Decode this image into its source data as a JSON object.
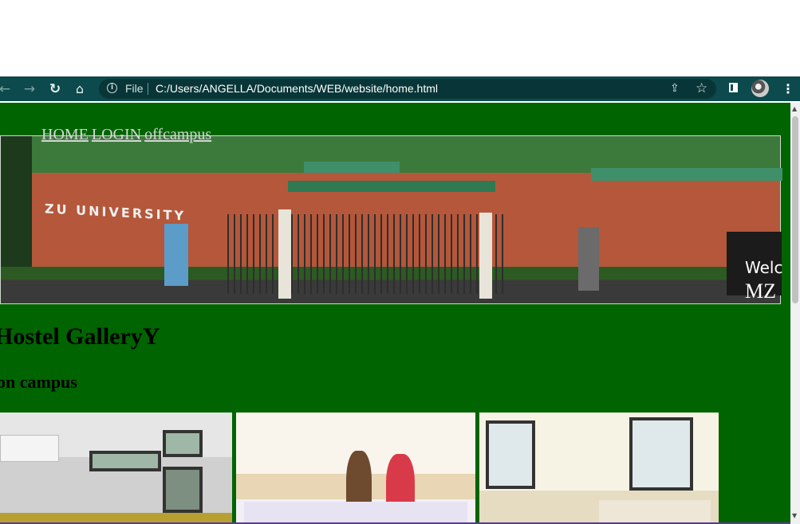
{
  "browser": {
    "url": "C:/Users/ANGELLA/Documents/WEB/website/home.html",
    "file_label": "File",
    "icons": [
      "back-arrow-icon",
      "forward-arrow-icon",
      "reload-icon",
      "home-icon",
      "info-icon",
      "share-icon",
      "star-icon",
      "side-panel-icon",
      "avatar",
      "kebab-menu-icon"
    ]
  },
  "nav": {
    "links": [
      {
        "label": "HOME"
      },
      {
        "label": "LOGIN"
      },
      {
        "label": "offcampus"
      }
    ]
  },
  "banner": {
    "sign_text": "ZU UNIVERSITY",
    "welcome_text": "Welc",
    "mz_text": "MZ"
  },
  "gallery": {
    "title": "Hostel GalleryY",
    "section": "on campus"
  },
  "colors": {
    "page_background": "#006400",
    "toolbar": "#0c4a4d",
    "link": "#d6d6d6"
  }
}
